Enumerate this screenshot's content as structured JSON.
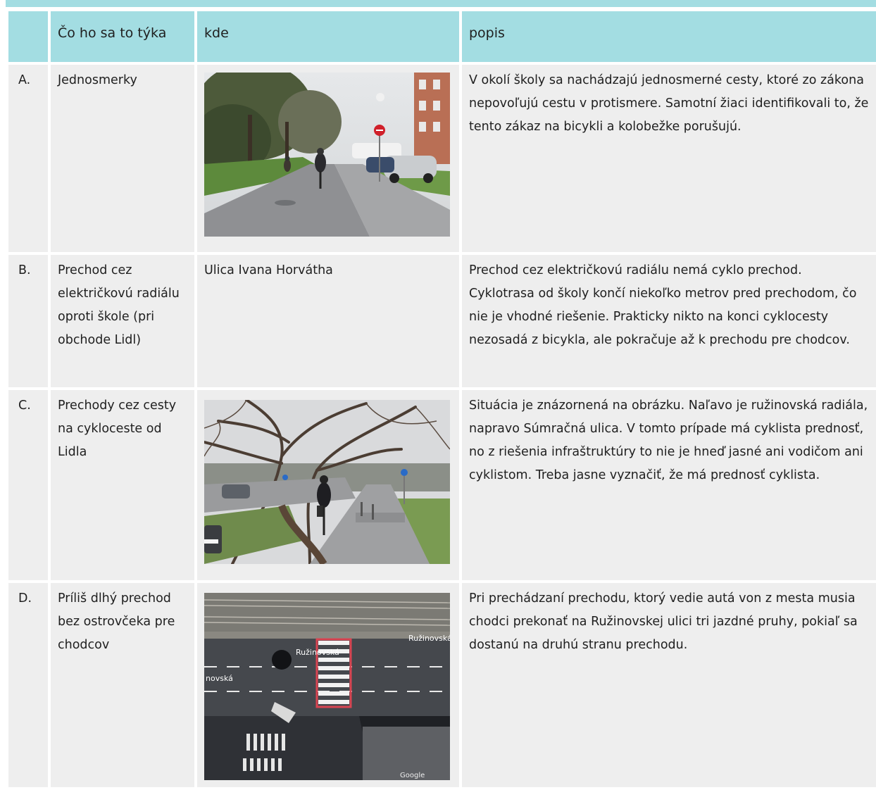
{
  "table": {
    "headers": [
      "",
      "Čo ho sa to týka",
      "kde",
      "popis"
    ],
    "rows": [
      {
        "letter": "A.",
        "topic": "Jednosmerky",
        "where": "",
        "photo": "cyclists-on-one-way-street-photo",
        "description": "V okolí školy sa nachádzajú jednosmerné cesty, ktoré zo zákona nepovoľujú cestu v protismere. Samotní žiaci identifikovali to, že tento zákaz na bicykli a kolobežke porušujú."
      },
      {
        "letter": "B.",
        "topic": "Prechod cez električkovú radiálu oproti škole (pri obchode Lidl)",
        "where": "Ulica Ivana Horvátha",
        "photo": "",
        "description": "Prechod cez električkovú radiálu nemá cyklo prechod. Cyklotrasa od školy končí niekoľko metrov pred prechodom, čo nie je vhodné riešenie. Prakticky nikto na konci cyklocesty nezosadá z bicykla, ale pokračuje až k prechodu pre chodcov."
      },
      {
        "letter": "C.",
        "topic": "Prechody cez cesty na cykloceste od Lidla",
        "where": "",
        "photo": "cyclist-on-cycle-path-under-trees-photo",
        "description": "Situácia je znázornená na obrázku. Naľavo je ružinovská radiála, napravo Súmračná ulica. V tomto prípade má cyklista prednosť, no z riešenia infraštruktúry to nie je hneď jasné ani vodičom ani cyklistom. Treba jasne vyznačiť, že má prednosť cyklista."
      },
      {
        "letter": "D.",
        "topic": "Príliš dlhý prechod bez ostrovčeka pre chodcov",
        "where": "",
        "photo": "aerial-view-crossing-photo",
        "photo_labels": [
          "Ružinovská",
          "Ružinovská",
          "novská",
          "Google"
        ],
        "description": "Pri prechádzaní prechodu, ktorý vedie autá von z mesta musia chodci prekonať na Ružinovskej ulici tri jazdné pruhy, pokiaľ sa dostanú na druhú stranu prechodu."
      }
    ]
  }
}
